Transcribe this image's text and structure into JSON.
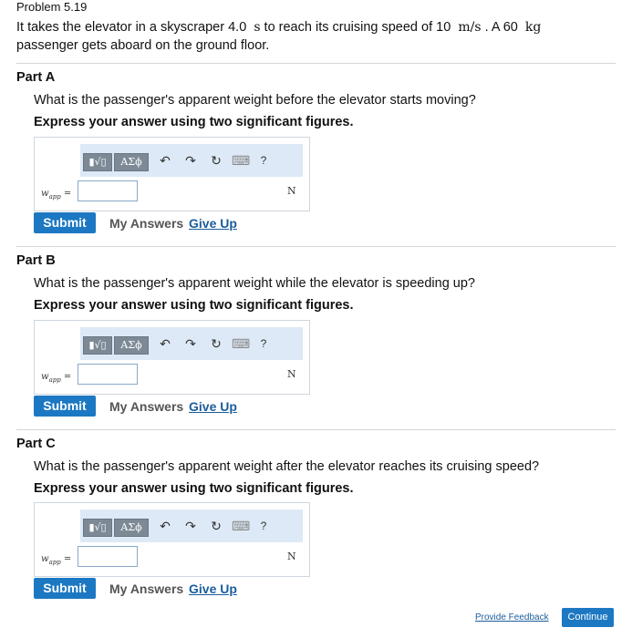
{
  "problem": {
    "title": "Problem 5.19",
    "intro_1": "It takes the elevator in a skyscraper 4.0",
    "intro_unit_s": "s",
    "intro_2": "to reach its cruising speed of 10",
    "intro_unit_ms": "m/s",
    "intro_3": ". A 60",
    "intro_unit_kg": "kg",
    "intro_4": "passenger gets aboard on the ground floor."
  },
  "toolbar": {
    "fraction_sqrt": "▮√▯",
    "greek": "ΑΣϕ",
    "undo": "↶",
    "redo": "↷",
    "reset": "↻",
    "keyboard": "⌨",
    "help": "?"
  },
  "parts": [
    {
      "label": "Part A",
      "question": "What is the passenger's apparent weight before the elevator starts moving?",
      "instruction": "Express your answer using two significant figures.",
      "variable": "w",
      "variable_sub": "app",
      "equals": "=",
      "answer_value": "",
      "unit": "N",
      "submit_label": "Submit",
      "my_answers_label": "My Answers",
      "give_up_label": "Give Up"
    },
    {
      "label": "Part B",
      "question": "What is the passenger's apparent weight while the elevator is speeding up?",
      "instruction": "Express your answer using two significant figures.",
      "variable": "w",
      "variable_sub": "app",
      "equals": "=",
      "answer_value": "",
      "unit": "N",
      "submit_label": "Submit",
      "my_answers_label": "My Answers",
      "give_up_label": "Give Up"
    },
    {
      "label": "Part C",
      "question": "What is the passenger's apparent weight after the elevator reaches its cruising speed?",
      "instruction": "Express your answer using two significant figures.",
      "variable": "w",
      "variable_sub": "app",
      "equals": "=",
      "answer_value": "",
      "unit": "N",
      "submit_label": "Submit",
      "my_answers_label": "My Answers",
      "give_up_label": "Give Up"
    }
  ],
  "footer": {
    "provide_feedback": "Provide Feedback",
    "continue_label": "Continue"
  }
}
